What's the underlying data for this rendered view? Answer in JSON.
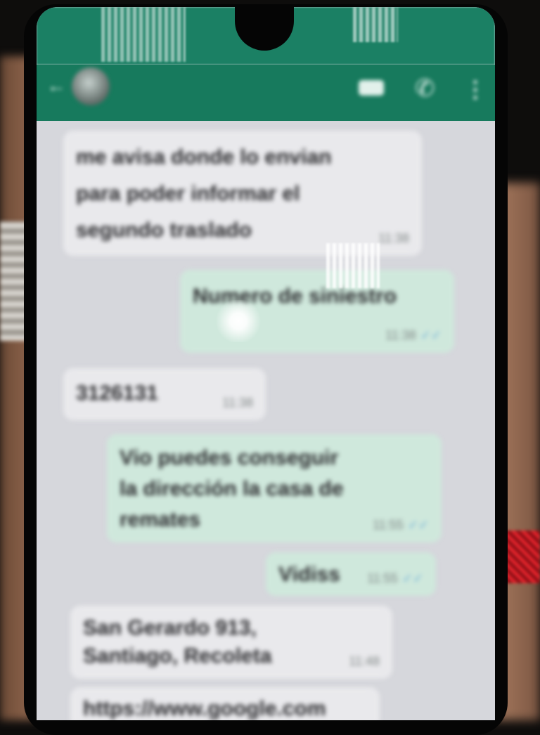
{
  "status_bar": {
    "time": "",
    "icons": ""
  },
  "header": {
    "contact_name": "",
    "contact_subtitle": "",
    "icons": [
      "back-icon",
      "avatar",
      "video-call-icon",
      "phone-call-icon",
      "menu-icon"
    ]
  },
  "messages": [
    {
      "direction": "incoming",
      "text": "me avisa donde lo envian\npara poder informar el\nsegundo traslado",
      "time": "11:38"
    },
    {
      "direction": "outgoing",
      "text": "Numero de siniestro",
      "time": "11:38"
    },
    {
      "direction": "incoming",
      "text": "3126131",
      "time": "11:38"
    },
    {
      "direction": "outgoing",
      "text": "Vio puedes conseguir\nla dirección la casa de\nremates",
      "time": "11:55"
    },
    {
      "direction": "outgoing",
      "text": "Vidiss",
      "time": "11:55"
    },
    {
      "direction": "incoming",
      "text": "San Gerardo 913,\nSantiago, Recoleta",
      "time": "11:48"
    },
    {
      "direction": "incoming",
      "text": "https://www.google.com",
      "time": ""
    }
  ],
  "colors": {
    "header": "#177a5d",
    "chat_background": "#d6d7dc",
    "incoming_bubble": "#e9e9ec",
    "outgoing_bubble": "#cfe8dc",
    "read_tick": "#6fb0d8"
  }
}
